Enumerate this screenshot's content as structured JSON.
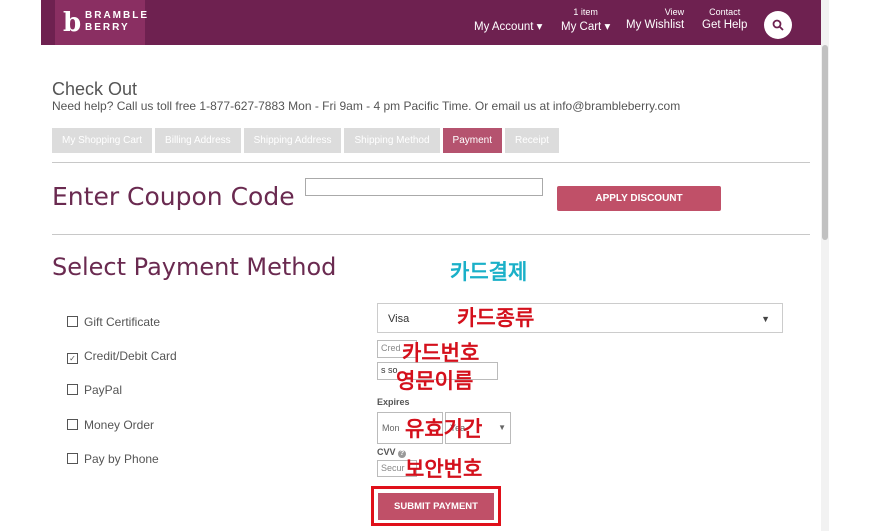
{
  "header": {
    "logo_mark": "b",
    "logo_line1": "BRAMBLE",
    "logo_line2": "BERRY",
    "my_account": "My Account ▾",
    "cart_count": "1 item",
    "my_cart": "My Cart ▾",
    "view": "View",
    "my_wishlist": "My Wishlist",
    "contact": "Contact",
    "get_help": "Get Help",
    "search_icon": "search-icon"
  },
  "checkout": {
    "title": "Check Out",
    "help_text": "Need help? Call us toll free 1-877-627-7883 Mon - Fri 9am - 4 pm Pacific Time. Or email us at info@brambleberry.com",
    "tabs": [
      {
        "label": "My Shopping Cart"
      },
      {
        "label": "Billing Address"
      },
      {
        "label": "Shipping Address"
      },
      {
        "label": "Shipping Method"
      },
      {
        "label": "Payment"
      },
      {
        "label": "Receipt"
      }
    ]
  },
  "coupon": {
    "label": "Enter Coupon Code",
    "input_value": "",
    "apply_label": "APPLY DISCOUNT"
  },
  "payment": {
    "title": "Select Payment Method",
    "options": [
      {
        "label": "Gift Certificate",
        "checked": false
      },
      {
        "label": "Credit/Debit Card",
        "checked": true
      },
      {
        "label": "PayPal",
        "checked": false
      },
      {
        "label": "Money Order",
        "checked": false
      },
      {
        "label": "Pay by Phone",
        "checked": false
      }
    ],
    "card_type": "Visa",
    "card_number_placeholder": "Cred",
    "name_value": "s so",
    "expires_label": "Expires",
    "month_placeholder": "Mon",
    "year_placeholder": "Yea",
    "cvv_label": "CVV",
    "cvv_help": "?",
    "cvv_placeholder": "Secur",
    "submit_label": "SUBMIT PAYMENT"
  },
  "annotations": {
    "card_payment": "카드결제",
    "card_type": "카드종류",
    "card_number": "카드번호",
    "english_name": "영문이름",
    "expiry": "유효기간",
    "security_code": "보안번호"
  },
  "colors": {
    "header_bg": "#6e2150",
    "accent_button": "#c05068",
    "annotation_red": "#d4101c",
    "annotation_blue": "#1ab0c8"
  }
}
